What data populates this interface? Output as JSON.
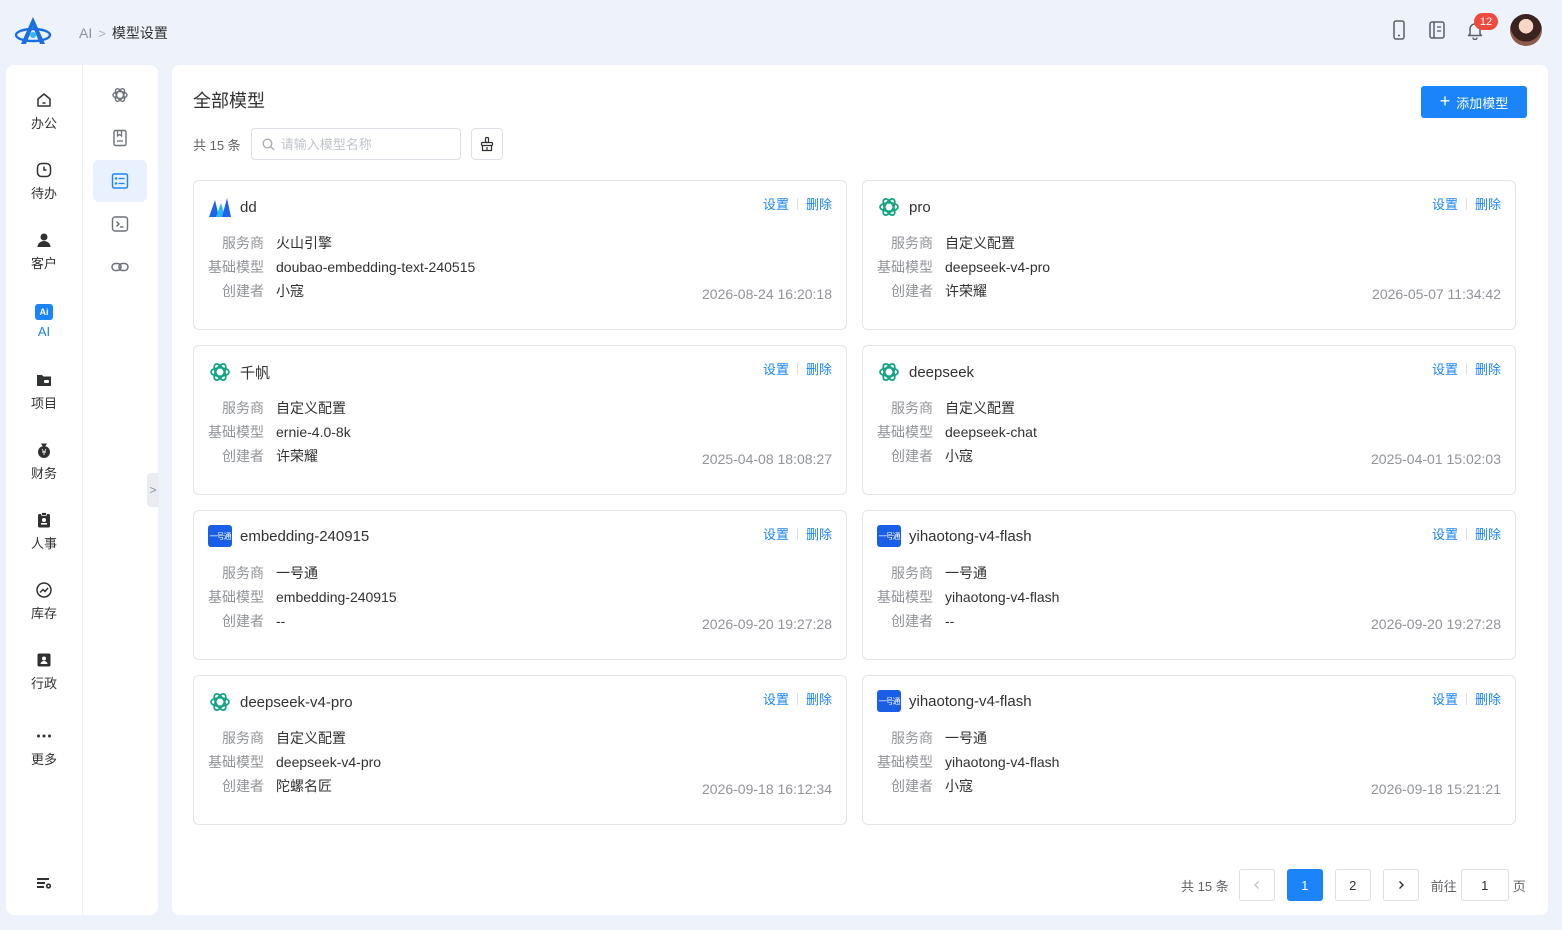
{
  "breadcrumb": {
    "root": "AI",
    "current": "模型设置"
  },
  "notifications": {
    "count": "12"
  },
  "nav": {
    "items": [
      {
        "label": "办公",
        "icon": "home-icon"
      },
      {
        "label": "待办",
        "icon": "clock-icon"
      },
      {
        "label": "客户",
        "icon": "user-icon"
      },
      {
        "label": "AI",
        "icon": "ai-icon",
        "badge": "Ai"
      },
      {
        "label": "项目",
        "icon": "folder-icon"
      },
      {
        "label": "财务",
        "icon": "money-bag-icon"
      },
      {
        "label": "人事",
        "icon": "clipboard-icon"
      },
      {
        "label": "库存",
        "icon": "trend-icon"
      },
      {
        "label": "行政",
        "icon": "id-card-icon"
      },
      {
        "label": "更多",
        "icon": "more-icon"
      }
    ]
  },
  "main": {
    "title": "全部模型",
    "add_button": "添加模型",
    "total": "共 15 条",
    "search_placeholder": "请输入模型名称"
  },
  "card_labels": {
    "provider": "服务商",
    "base_model": "基础模型",
    "creator": "创建者",
    "settings": "设置",
    "delete": "删除"
  },
  "icon_texts": {
    "yihaotong": "一号通"
  },
  "models": [
    {
      "name": "dd",
      "icon": "volcano-icon",
      "provider": "火山引擎",
      "base_model": "doubao-embedding-text-240515",
      "creator": "小寇",
      "time": "2026-08-24 16:20:18"
    },
    {
      "name": "pro",
      "icon": "openai-icon",
      "provider": "自定义配置",
      "base_model": "deepseek-v4-pro",
      "creator": "许荣耀",
      "time": "2026-05-07 11:34:42"
    },
    {
      "name": "千帆",
      "icon": "openai-icon",
      "provider": "自定义配置",
      "base_model": "ernie-4.0-8k",
      "creator": "许荣耀",
      "time": "2025-04-08 18:08:27"
    },
    {
      "name": "deepseek",
      "icon": "openai-icon",
      "provider": "自定义配置",
      "base_model": "deepseek-chat",
      "creator": "小寇",
      "time": "2025-04-01 15:02:03"
    },
    {
      "name": "embedding-240915",
      "icon": "yihaotong-icon",
      "provider": "一号通",
      "base_model": "embedding-240915",
      "creator": "--",
      "time": "2026-09-20 19:27:28"
    },
    {
      "name": "yihaotong-v4-flash",
      "icon": "yihaotong-icon",
      "provider": "一号通",
      "base_model": "yihaotong-v4-flash",
      "creator": "--",
      "time": "2026-09-20 19:27:28"
    },
    {
      "name": "deepseek-v4-pro",
      "icon": "openai-icon",
      "provider": "自定义配置",
      "base_model": "deepseek-v4-pro",
      "creator": "陀螺名匠",
      "time": "2026-09-18 16:12:34"
    },
    {
      "name": "yihaotong-v4-flash",
      "icon": "yihaotong-icon",
      "provider": "一号通",
      "base_model": "yihaotong-v4-flash",
      "creator": "小寇",
      "time": "2026-09-18 15:21:21"
    }
  ],
  "pagination": {
    "total": "共 15 条",
    "pages": [
      "1",
      "2"
    ],
    "current": "1",
    "goto_prefix": "前往",
    "goto_value": "1",
    "goto_suffix": "页"
  },
  "colors": {
    "primary": "#1a84f8",
    "openai_green": "#10a37f",
    "yihaotong_blue": "#1a5ee8",
    "badge_red": "#f04a3e"
  }
}
